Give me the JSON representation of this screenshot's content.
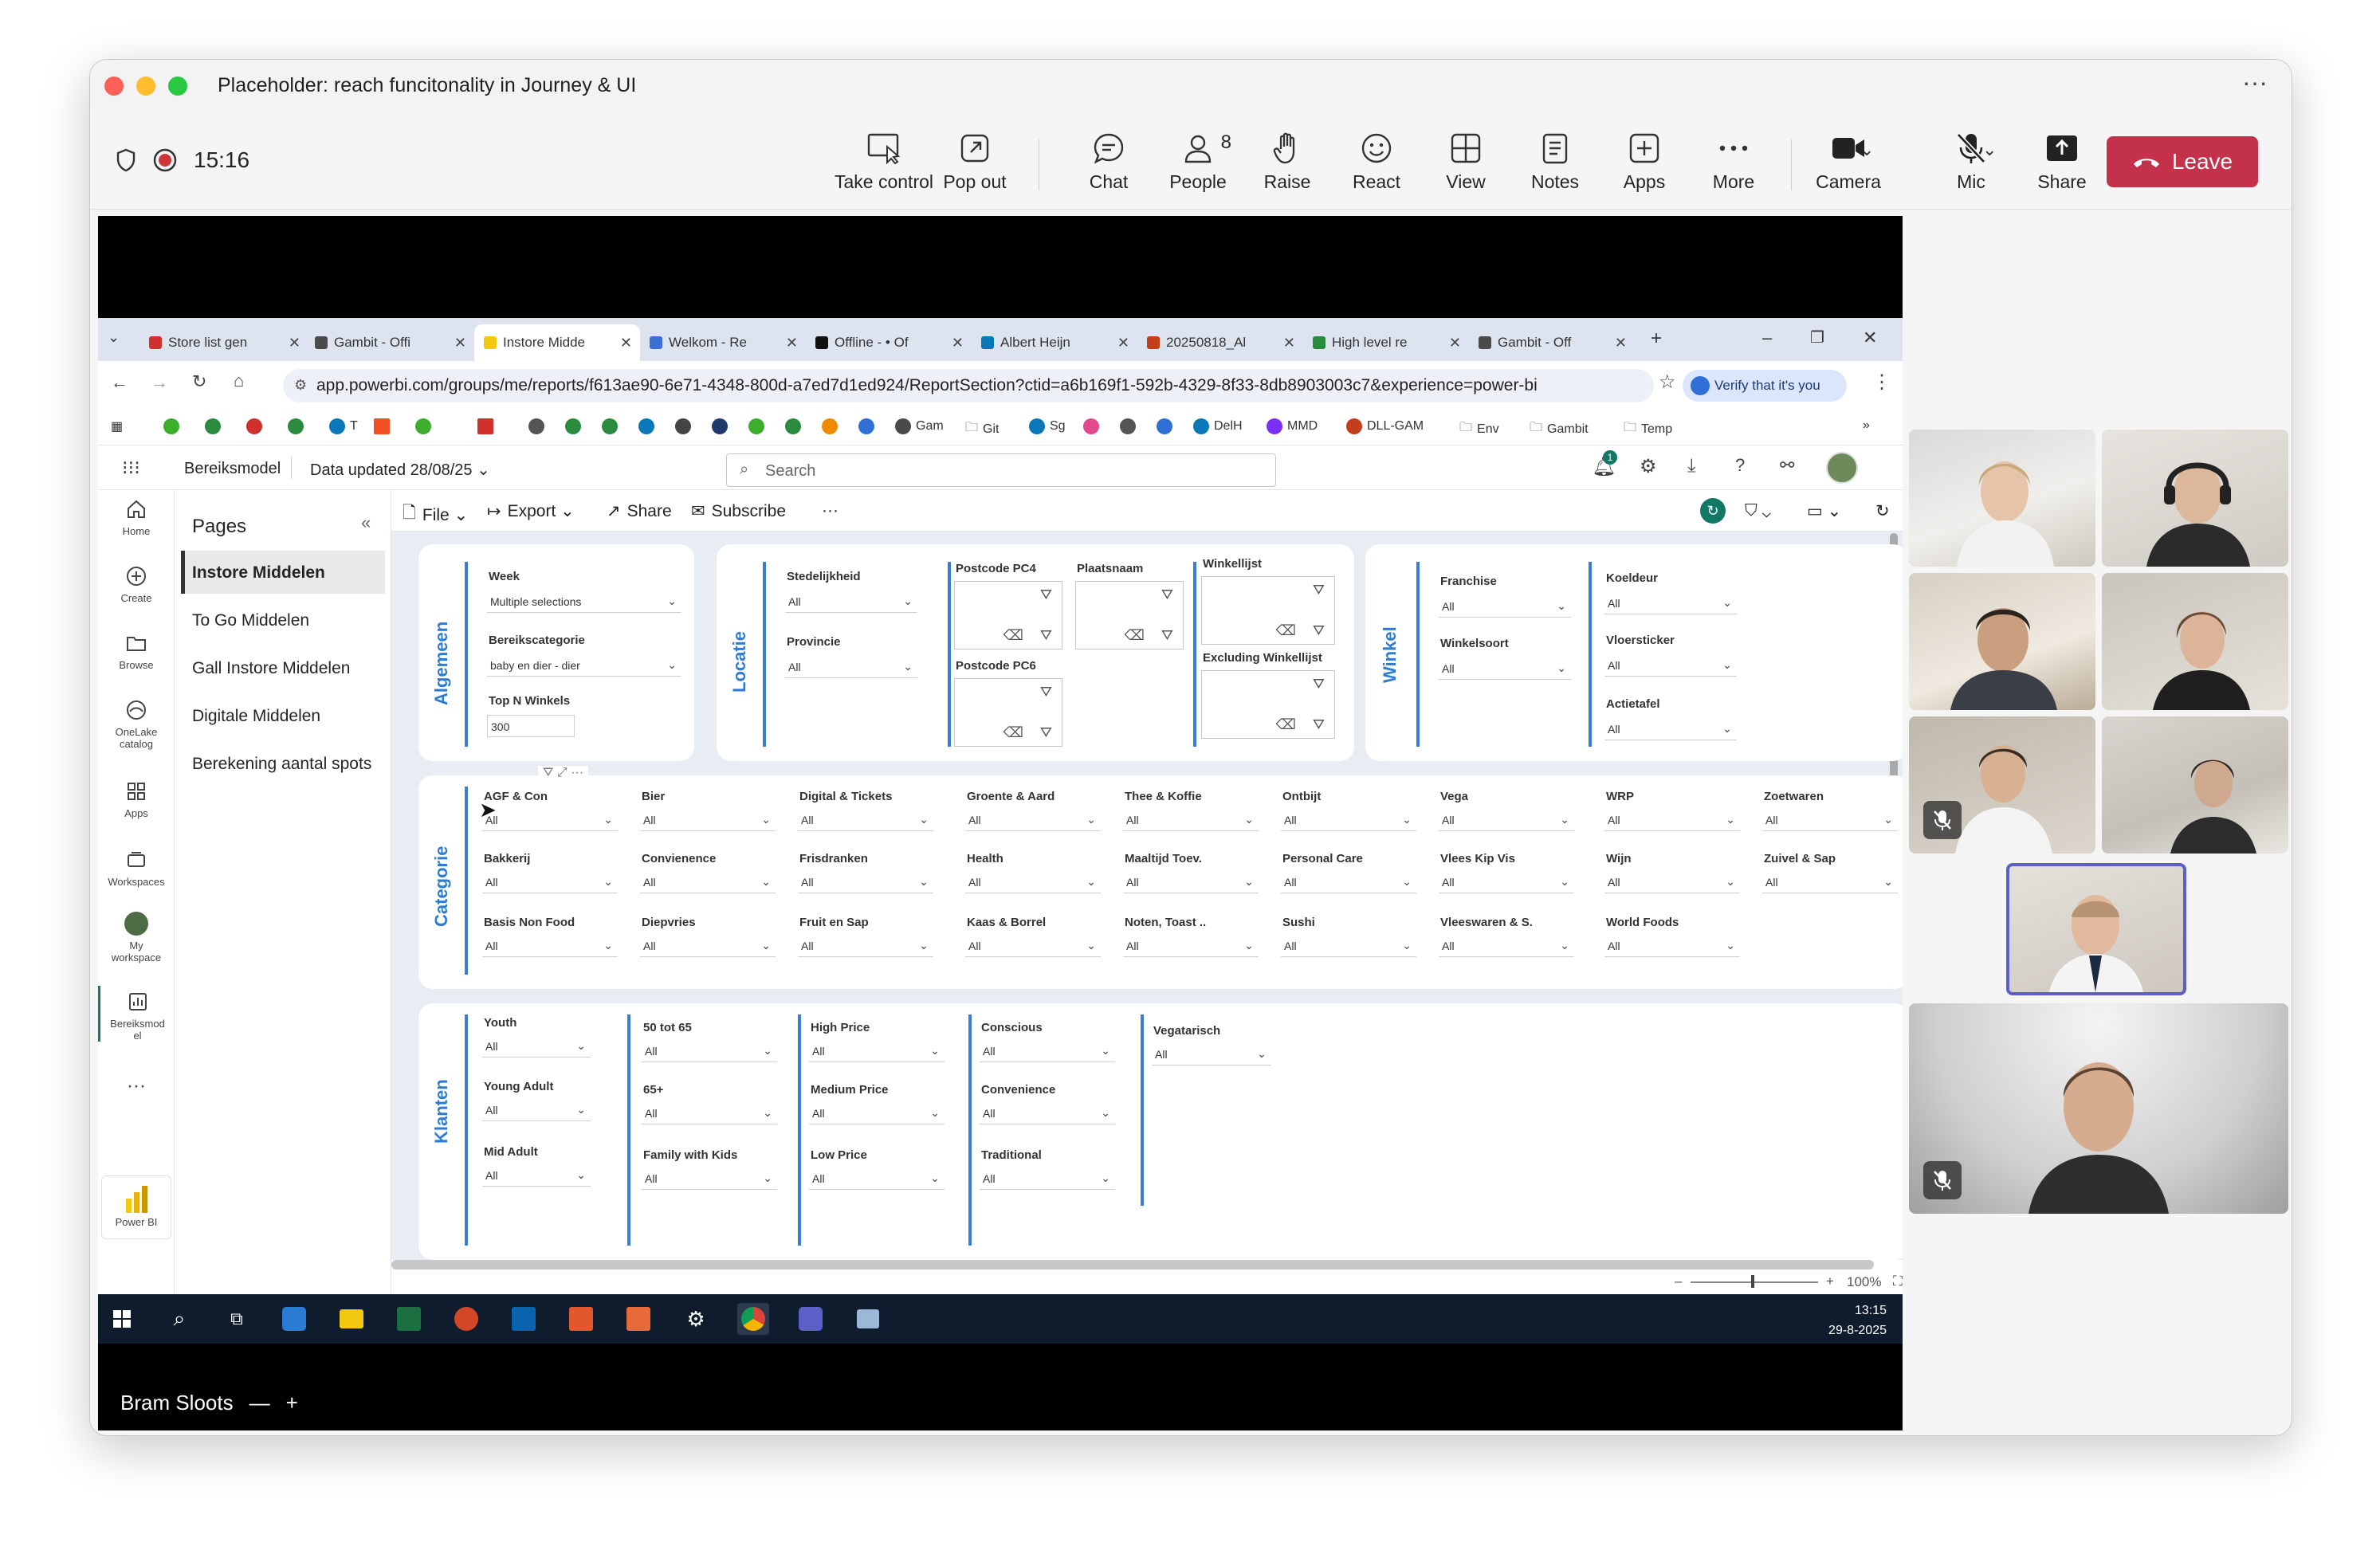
{
  "window": {
    "title": "Placeholder: reach funcitonality in Journey & UI"
  },
  "meeting": {
    "time": "15:16",
    "toolbar": [
      {
        "label": "Take control",
        "icon": "take-control-icon"
      },
      {
        "label": "Pop out",
        "icon": "pop-out-icon"
      },
      {
        "label": "Chat",
        "icon": "chat-icon"
      },
      {
        "label": "People",
        "icon": "people-icon",
        "badge": "8"
      },
      {
        "label": "Raise",
        "icon": "raise-hand-icon"
      },
      {
        "label": "React",
        "icon": "react-icon"
      },
      {
        "label": "View",
        "icon": "view-icon"
      },
      {
        "label": "Notes",
        "icon": "notes-icon"
      },
      {
        "label": "Apps",
        "icon": "apps-icon"
      },
      {
        "label": "More",
        "icon": "more-icon"
      },
      {
        "label": "Camera",
        "icon": "camera-icon"
      },
      {
        "label": "Mic",
        "icon": "mic-off-icon"
      },
      {
        "label": "Share",
        "icon": "share-icon"
      }
    ],
    "leave_label": "Leave",
    "presenter_name": "Bram Sloots",
    "colors": {
      "leave": "#c4314b",
      "active_speaker": "#5b5fc7"
    }
  },
  "browser": {
    "tabs": [
      {
        "title": "Store list gen",
        "color": "#d0312d"
      },
      {
        "title": "Gambit - Offi",
        "color": "#4a4a4a"
      },
      {
        "title": "Instore Midde",
        "color": "#f2c811",
        "active": true
      },
      {
        "title": "Welkom - Re",
        "color": "#3b6fd1"
      },
      {
        "title": "Offline - • Of",
        "color": "#111111"
      },
      {
        "title": "Albert Heijn",
        "color": "#0a77b8"
      },
      {
        "title": "20250818_Al",
        "color": "#c43e1c"
      },
      {
        "title": "High level re",
        "color": "#2a8a3e"
      },
      {
        "title": "Gambit - Off",
        "color": "#4a4a4a"
      }
    ],
    "url": "app.powerbi.com/groups/me/reports/f613ae90-6e71-4348-800d-a7ed7d1ed924/ReportSection?ctid=a6b169f1-592b-4329-8f33-8db8903003c7&experience=power-bi",
    "verify_label": "Verify that it's you",
    "bookmarks": [
      {
        "label": "T",
        "color": "#0a77b8"
      },
      {
        "label": "Gam",
        "color": "#4a4a4a"
      },
      {
        "label": "Git",
        "folder": true
      },
      {
        "label": "Sg",
        "color": "#0a77b8"
      },
      {
        "label": "DelH",
        "color": "#0a77b8"
      },
      {
        "label": "MMD",
        "color": "#7b2ff7"
      },
      {
        "label": "DLL-GAM",
        "color": "#c43e1c"
      },
      {
        "label": "Env",
        "folder": true
      },
      {
        "label": "Gambit",
        "folder": true
      },
      {
        "label": "Temp",
        "folder": true
      }
    ]
  },
  "powerbi": {
    "report_name": "Bereiksmodel",
    "data_updated": "Data updated 28/08/25",
    "search_placeholder": "Search",
    "notification_count": "1",
    "nav": [
      {
        "label": "Home",
        "icon": "home-icon"
      },
      {
        "label": "Create",
        "icon": "create-icon"
      },
      {
        "label": "Browse",
        "icon": "browse-icon"
      },
      {
        "label": "OneLake catalog",
        "icon": "onelake-icon"
      },
      {
        "label": "Apps",
        "icon": "apps-icon"
      },
      {
        "label": "Workspaces",
        "icon": "workspaces-icon"
      },
      {
        "label": "My workspace",
        "icon": "my-workspace-icon"
      },
      {
        "label": "Bereiksmod el",
        "icon": "report-icon"
      }
    ],
    "power_bi_label": "Power BI",
    "pages_title": "Pages",
    "pages": [
      "Instore Middelen",
      "To Go Middelen",
      "Gall Instore Middelen",
      "Digitale Middelen",
      "Berekening aantal spots"
    ],
    "toolbar": {
      "file": "File",
      "export": "Export",
      "share": "Share",
      "subscribe": "Subscribe"
    },
    "zoom": "100%",
    "sections": {
      "algemeen": "Algemeen",
      "locatie": "Locatie",
      "winkel": "Winkel",
      "categorie": "Categorie",
      "klanten": "Klanten"
    },
    "algemeen": {
      "week_label": "Week",
      "week_value": "Multiple selections",
      "cat_label": "Bereikscategorie",
      "cat_value": "baby en dier - dier",
      "topn_label": "Top N Winkels",
      "topn_value": "300"
    },
    "locatie": {
      "stedelijkheid_label": "Stedelijkheid",
      "stedelijkheid_value": "All",
      "provincie_label": "Provincie",
      "provincie_value": "All",
      "pc4": "Postcode PC4",
      "plaatsnaam": "Plaatsnaam",
      "pc6": "Postcode PC6",
      "winkellijst": "Winkellijst",
      "excluding": "Excluding Winkellijst"
    },
    "winkel": [
      {
        "label": "Franchise",
        "value": "All"
      },
      {
        "label": "Winkelsoort",
        "value": "All"
      },
      {
        "label": "Koeldeur",
        "value": "All"
      },
      {
        "label": "Vloersticker",
        "value": "All"
      },
      {
        "label": "Actietafel",
        "value": "All"
      }
    ],
    "categorie": [
      [
        {
          "label": "AGF & Con",
          "value": "All"
        },
        {
          "label": "Bier",
          "value": "All"
        },
        {
          "label": "Digital & Tickets",
          "value": "All"
        },
        {
          "label": "Groente & Aard",
          "value": "All"
        },
        {
          "label": "Thee & Koffie",
          "value": "All"
        },
        {
          "label": "Ontbijt",
          "value": "All"
        },
        {
          "label": "Vega",
          "value": "All"
        },
        {
          "label": "WRP",
          "value": "All"
        },
        {
          "label": "Zoetwaren",
          "value": "All"
        }
      ],
      [
        {
          "label": "Bakkerij",
          "value": "All"
        },
        {
          "label": "Convienence",
          "value": "All"
        },
        {
          "label": "Frisdranken",
          "value": "All"
        },
        {
          "label": "Health",
          "value": "All"
        },
        {
          "label": "Maaltijd Toev.",
          "value": "All"
        },
        {
          "label": "Personal Care",
          "value": "All"
        },
        {
          "label": "Vlees Kip Vis",
          "value": "All"
        },
        {
          "label": "Wijn",
          "value": "All"
        },
        {
          "label": "Zuivel & Sap",
          "value": "All"
        }
      ],
      [
        {
          "label": "Basis Non Food",
          "value": "All"
        },
        {
          "label": "Diepvries",
          "value": "All"
        },
        {
          "label": "Fruit en Sap",
          "value": "All"
        },
        {
          "label": "Kaas & Borrel",
          "value": "All"
        },
        {
          "label": "Noten, Toast ..",
          "value": "All"
        },
        {
          "label": "Sushi",
          "value": "All"
        },
        {
          "label": "Vleeswaren & S.",
          "value": "All"
        },
        {
          "label": "World Foods",
          "value": "All"
        }
      ]
    ],
    "klanten": [
      [
        {
          "label": "Youth",
          "value": "All"
        },
        {
          "label": "Young Adult",
          "value": "All"
        },
        {
          "label": "Mid Adult",
          "value": "All"
        }
      ],
      [
        {
          "label": "50 tot 65",
          "value": "All"
        },
        {
          "label": "65+",
          "value": "All"
        },
        {
          "label": "Family with Kids",
          "value": "All"
        }
      ],
      [
        {
          "label": "High Price",
          "value": "All"
        },
        {
          "label": "Medium Price",
          "value": "All"
        },
        {
          "label": "Low Price",
          "value": "All"
        }
      ],
      [
        {
          "label": "Conscious",
          "value": "All"
        },
        {
          "label": "Convenience",
          "value": "All"
        },
        {
          "label": "Traditional",
          "value": "All"
        }
      ],
      [
        {
          "label": "Vegatarisch",
          "value": "All"
        }
      ]
    ]
  },
  "taskbar": {
    "time": "13:15",
    "date": "29-8-2025"
  }
}
